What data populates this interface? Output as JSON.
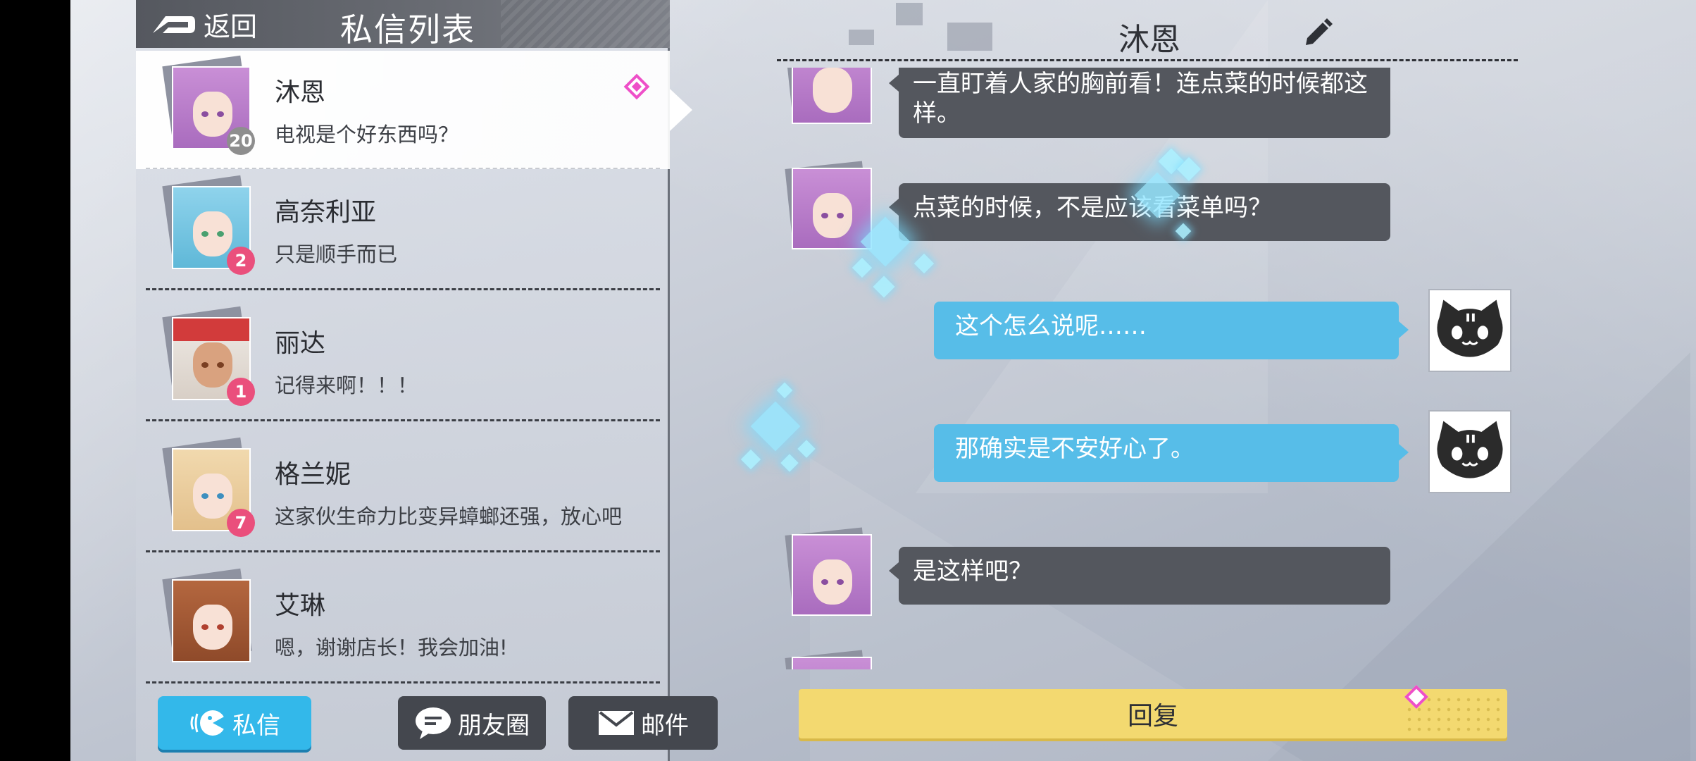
{
  "header": {
    "back_label": "返回",
    "title": "私信列表"
  },
  "conversations": [
    {
      "name": "沐恩",
      "message": "电视是个好东西吗？",
      "badge": "20",
      "active": true
    },
    {
      "name": "高奈利亚",
      "message": "只是顺手而已",
      "badge": "2"
    },
    {
      "name": "丽达",
      "message": "记得来啊！！！",
      "badge": "1"
    },
    {
      "name": "格兰妮",
      "message": "这家伙生命力比变异蟑螂还强，放心吧",
      "badge": "7"
    },
    {
      "name": "艾琳",
      "message": "嗯，谢谢店长！我会加油!",
      "badge": ""
    }
  ],
  "tabs": {
    "private": "私信",
    "moments": "朋友圈",
    "mail": "邮件"
  },
  "chat": {
    "title": "沐恩",
    "messages": [
      {
        "from": "other",
        "text_line1": "一直盯着人家的胸前看！连点菜的时候都这",
        "text_line2": "样。"
      },
      {
        "from": "other",
        "text": "点菜的时候，不是应该看菜单吗？"
      },
      {
        "from": "self",
        "text": "这个怎么说呢……"
      },
      {
        "from": "self",
        "text": "那确实是不安好心了。"
      },
      {
        "from": "other",
        "text": "是这样吧？"
      }
    ],
    "reply_label": "回复"
  },
  "colors": {
    "accent_blue": "#33b8ea",
    "bubble_dark": "#54575e",
    "bubble_blue": "#57bde8",
    "reply_yellow": "#f3d970",
    "badge_pink": "#ea4f7c",
    "marker_magenta": "#ee4fc8"
  },
  "icons": [
    "back-arrow-icon",
    "diamond-marker-icon",
    "edit-pencil-icon",
    "chat-bubble-icon",
    "mail-icon",
    "cat-face-icon"
  ]
}
